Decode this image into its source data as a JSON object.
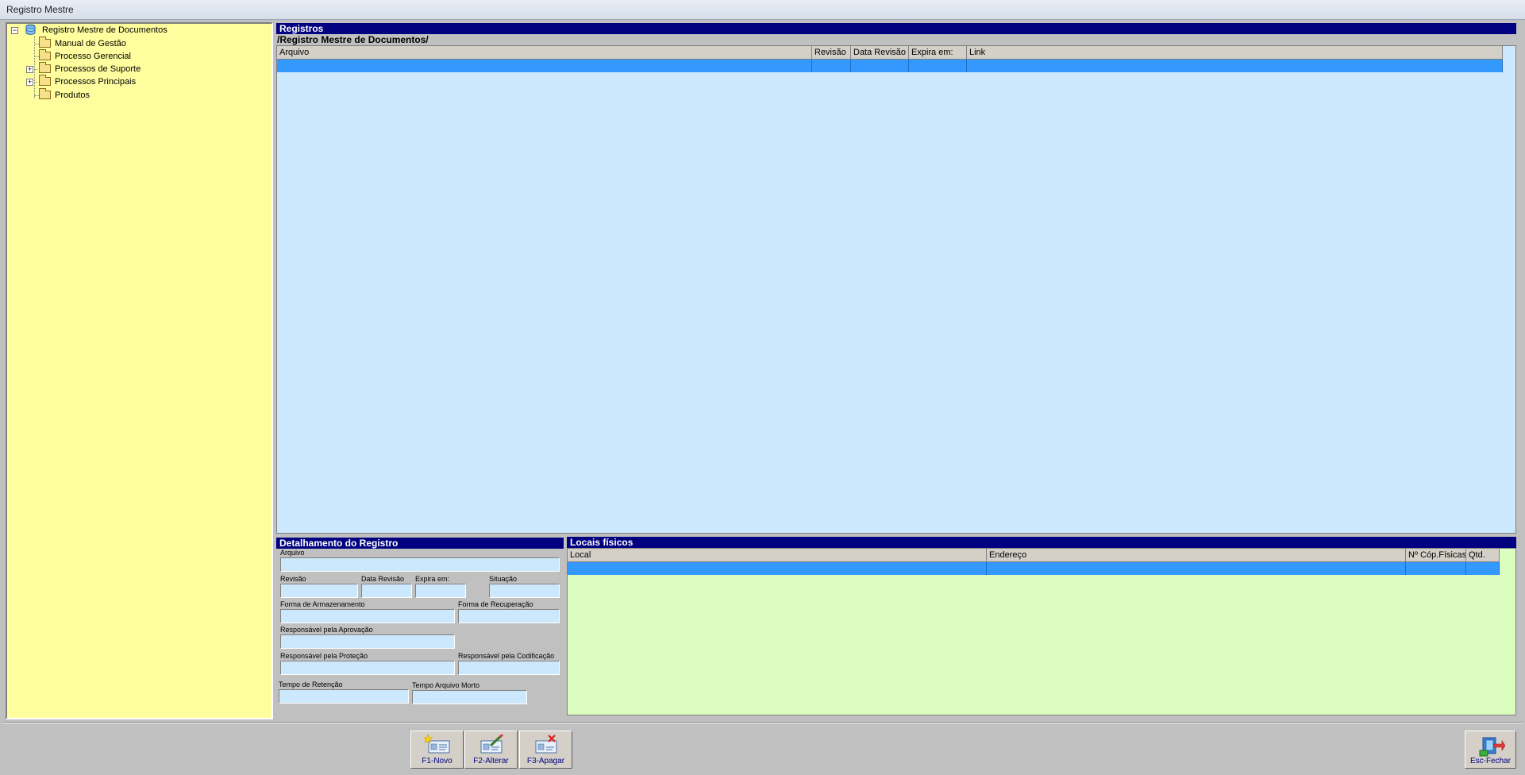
{
  "window": {
    "title": "Registro Mestre"
  },
  "tree": {
    "root": "Registro Mestre de Documentos",
    "items": [
      {
        "label": "Manual de Gestão",
        "expandable": false
      },
      {
        "label": "Processo Gerencial",
        "expandable": false
      },
      {
        "label": "Processos de Suporte",
        "expandable": true
      },
      {
        "label": "Processos Principais",
        "expandable": true
      },
      {
        "label": "Produtos",
        "expandable": false
      }
    ]
  },
  "registros": {
    "header": "Registros",
    "path": "/Registro Mestre de Documentos/",
    "columns": [
      "Arquivo",
      "Revisão",
      "Data Revisão",
      "Expira em:",
      "Link"
    ]
  },
  "detalhamento": {
    "header": "Detalhamento do Registro",
    "labels": {
      "arquivo": "Arquivo",
      "revisao": "Revisão",
      "data_revisao": "Data Revisão",
      "expira_em": "Expira em:",
      "situacao": "Situação",
      "forma_armazenamento": "Forma de Armazenamento",
      "forma_recuperacao": "Forma de Recuperação",
      "resp_aprovacao": "Responsável pela Aprovação",
      "resp_protecao": "Responsável pela Proteção",
      "resp_codificacao": "Responsável pela Codificação",
      "tempo_retencao": "Tempo de Retenção",
      "tempo_arquivo_morto": "Tempo Arquivo Morto"
    }
  },
  "locais": {
    "header": "Locais físicos",
    "columns": [
      "Local",
      "Endereço",
      "Nº Cóp.Físicas",
      "Qtd."
    ]
  },
  "toolbar": {
    "novo": "F1-Novo",
    "alterar": "F2-Alterar",
    "apagar": "F3-Apagar",
    "fechar": "Esc-Fechar"
  },
  "colors": {
    "tree_bg": "#fffe9f",
    "grid_bg": "#cce8fc",
    "locais_bg": "#dbfdc0",
    "header_bg": "#000080",
    "selection": "#3399ff"
  }
}
